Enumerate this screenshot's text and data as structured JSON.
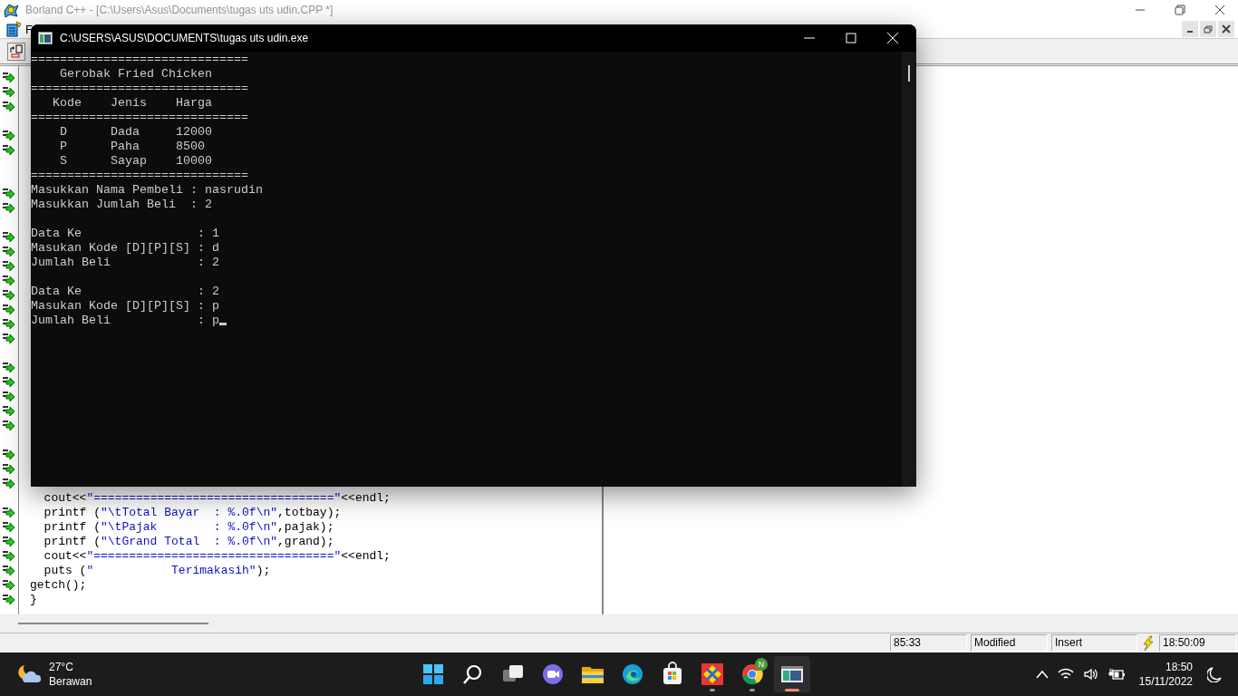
{
  "ide": {
    "title": "Borland C++ - [C:\\Users\\Asus\\Documents\\tugas uts udin.CPP *]",
    "active": false,
    "menu": [
      {
        "label": "F"
      }
    ],
    "gutter_marks": [
      true,
      true,
      true,
      false,
      true,
      true,
      false,
      false,
      true,
      true,
      false,
      true,
      true,
      true,
      true,
      true,
      true,
      true,
      true,
      false,
      true,
      true,
      true,
      true,
      true,
      false,
      true,
      true,
      true,
      false,
      true,
      true,
      true,
      true,
      true,
      true,
      true
    ],
    "code_lines": [
      [
        {
          "kind": "code",
          "text": "  cout<<"
        },
        {
          "kind": "string",
          "text": "\"==================================\""
        },
        {
          "kind": "code",
          "text": "<<endl;"
        }
      ],
      [
        {
          "kind": "code",
          "text": "  printf ("
        },
        {
          "kind": "string",
          "text": "\"\\tTotal Bayar  : %.0f\\n\""
        },
        {
          "kind": "code",
          "text": ",totbay);"
        }
      ],
      [
        {
          "kind": "code",
          "text": "  printf ("
        },
        {
          "kind": "string",
          "text": "\"\\tPajak        : %.0f\\n\""
        },
        {
          "kind": "code",
          "text": ",pajak);"
        }
      ],
      [
        {
          "kind": "code",
          "text": "  printf ("
        },
        {
          "kind": "string",
          "text": "\"\\tGrand Total  : %.0f\\n\""
        },
        {
          "kind": "code",
          "text": ",grand);"
        }
      ],
      [
        {
          "kind": "code",
          "text": "  cout<<"
        },
        {
          "kind": "string",
          "text": "\"==================================\""
        },
        {
          "kind": "code",
          "text": "<<endl;"
        }
      ],
      [
        {
          "kind": "code",
          "text": "  puts ("
        },
        {
          "kind": "string",
          "text": "\"           Terimakasih\""
        },
        {
          "kind": "code",
          "text": ");"
        }
      ],
      [
        {
          "kind": "code",
          "text": "getch();"
        }
      ],
      [
        {
          "kind": "code",
          "text": "}"
        }
      ]
    ],
    "status": [
      "85:33",
      "Modified",
      "Insert"
    ],
    "status_time": "18:50:09"
  },
  "console": {
    "title": "C:\\USERS\\ASUS\\DOCUMENTS\\tugas uts udin.exe",
    "cursor": true,
    "blocks": [
      [
        "==============================",
        "    Gerobak Fried Chicken",
        "==============================",
        "   Kode    Jenis    Harga",
        "==============================",
        "    D      Dada     12000",
        "    P      Paha     8500",
        "    S      Sayap    10000",
        "==============================",
        "Masukkan Nama Pembeli : nasrudin",
        "Masukkan Jumlah Beli  : 2"
      ],
      [
        "Data Ke                : 1",
        "Masukan Kode [D][P][S] : d",
        "Jumlah Beli            : 2"
      ],
      [
        "Data Ke                : 2",
        "Masukan Kode [D][P][S] : p",
        "Jumlah Beli            : p"
      ]
    ]
  },
  "taskbar": {
    "weather": {
      "temp": "27°C",
      "condition": "Berawan"
    },
    "apps": [
      {
        "kind": "start",
        "open": false,
        "active": false
      },
      {
        "kind": "search",
        "open": false,
        "active": false
      },
      {
        "kind": "taskview",
        "open": false,
        "active": false
      },
      {
        "kind": "meet",
        "open": false,
        "active": false
      },
      {
        "kind": "explorer",
        "open": false,
        "active": false
      },
      {
        "kind": "edge",
        "open": false,
        "active": false
      },
      {
        "kind": "store",
        "open": false,
        "active": false
      },
      {
        "kind": "borland",
        "open": true,
        "active": false
      },
      {
        "kind": "chrome",
        "open": true,
        "active": false,
        "badge": "N"
      },
      {
        "kind": "console",
        "open": true,
        "active": true
      }
    ],
    "time": "18:50",
    "date": "15/11/2022"
  }
}
